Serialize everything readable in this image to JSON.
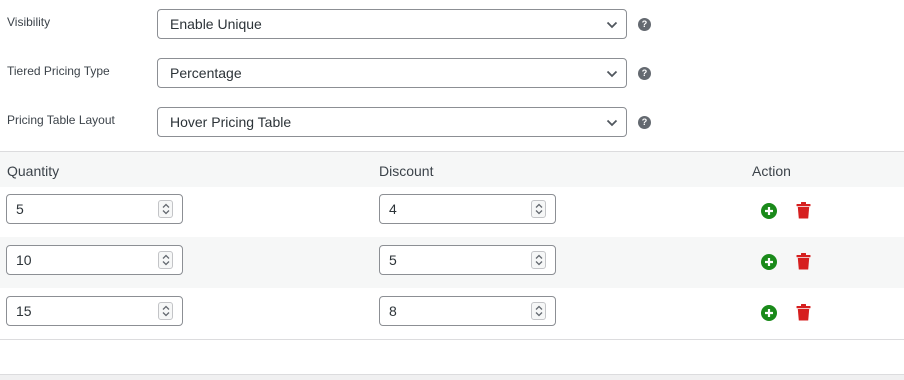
{
  "settings": {
    "visibility": {
      "label": "Visibility",
      "value": "Enable Unique"
    },
    "tiered_pricing_type": {
      "label": "Tiered Pricing Type",
      "value": "Percentage"
    },
    "pricing_table_layout": {
      "label": "Pricing Table Layout",
      "value": "Hover Pricing Table"
    }
  },
  "tier_table": {
    "headers": {
      "quantity": "Quantity",
      "discount": "Discount",
      "action": "Action"
    },
    "rows": [
      {
        "quantity": "5",
        "discount": "4"
      },
      {
        "quantity": "10",
        "discount": "5"
      },
      {
        "quantity": "15",
        "discount": "8"
      }
    ]
  },
  "colors": {
    "add": "#1a8a1a",
    "delete": "#d61f1f",
    "help": "#646970"
  },
  "icons": {
    "help": "question-circle-icon",
    "add": "plus-circle-icon",
    "delete": "trash-icon",
    "dropdown": "chevron-down-icon",
    "spinner": "spinner-arrows-icon"
  }
}
